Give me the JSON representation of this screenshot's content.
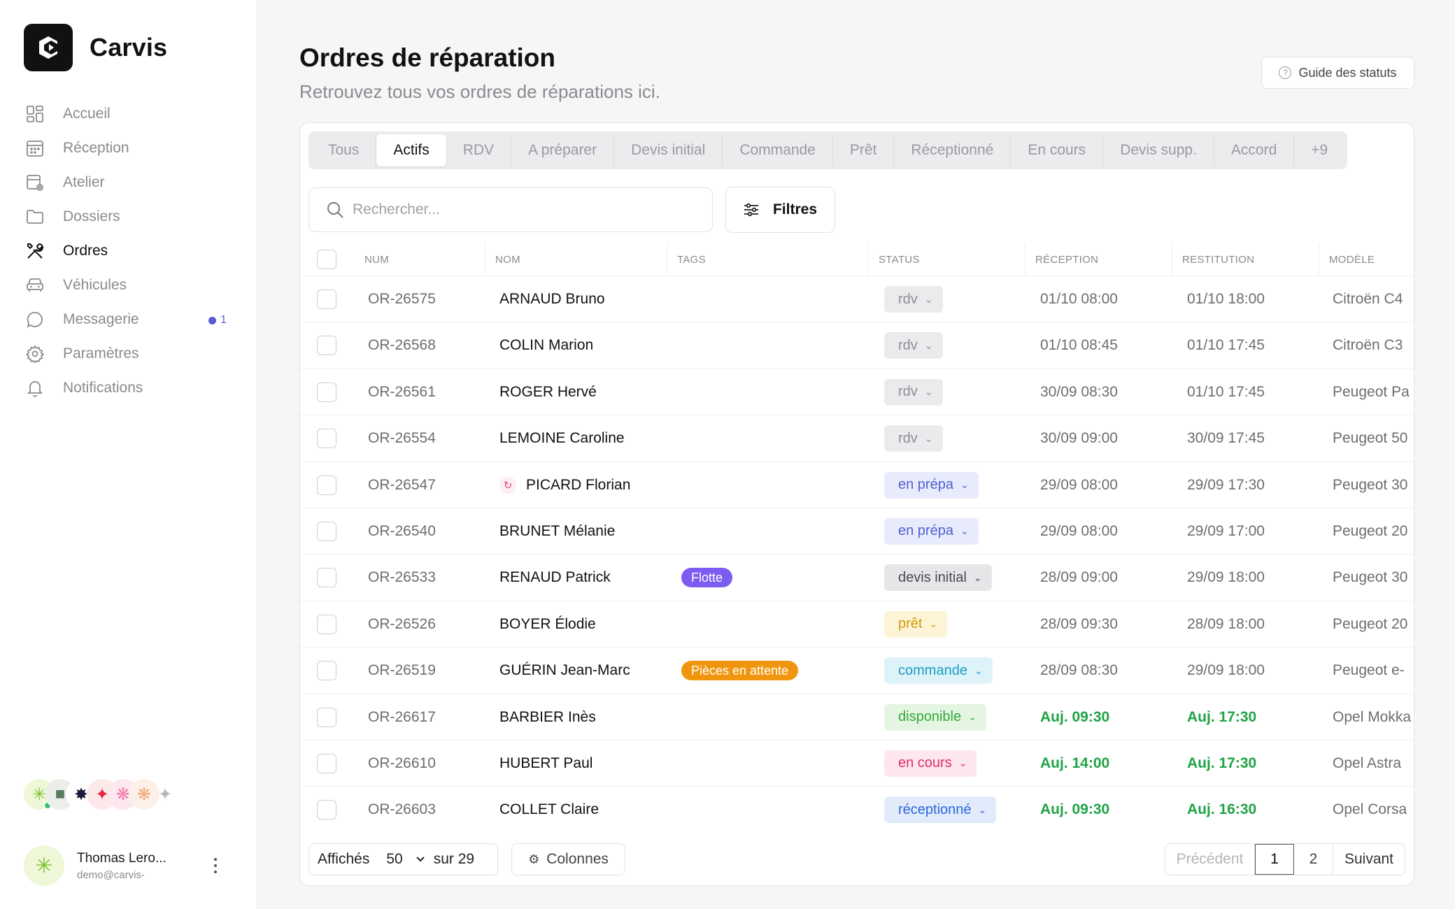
{
  "app": {
    "name": "Carvis"
  },
  "sidebar": {
    "items": [
      {
        "label": "Accueil",
        "icon": "dashboard-icon"
      },
      {
        "label": "Réception",
        "icon": "calendar-icon"
      },
      {
        "label": "Atelier",
        "icon": "workshop-icon"
      },
      {
        "label": "Dossiers",
        "icon": "folder-icon"
      },
      {
        "label": "Ordres",
        "icon": "tools-icon",
        "active": true
      },
      {
        "label": "Véhicules",
        "icon": "car-icon"
      },
      {
        "label": "Messagerie",
        "icon": "chat-icon",
        "badge": "1"
      },
      {
        "label": "Paramètres",
        "icon": "settings-icon"
      },
      {
        "label": "Notifications",
        "icon": "bell-icon"
      }
    ],
    "user": {
      "name": "Thomas Lero...",
      "email": "demo@carvis-"
    }
  },
  "header": {
    "title": "Ordres de réparation",
    "subtitle": "Retrouvez tous vos ordres de réparations ici.",
    "guide_label": "Guide des statuts"
  },
  "tabs": [
    "Tous",
    "Actifs",
    "RDV",
    "A préparer",
    "Devis initial",
    "Commande",
    "Prêt",
    "Réceptionné",
    "En cours",
    "Devis supp.",
    "Accord",
    "+9"
  ],
  "active_tab": "Actifs",
  "search": {
    "placeholder": "Rechercher..."
  },
  "filters_label": "Filtres",
  "columns": {
    "num": "NUM",
    "nom": "NOM",
    "tags": "TAGS",
    "status": "STATUS",
    "reception": "RÉCEPTION",
    "restitution": "RESTITUTION",
    "modele": "MODÈLE"
  },
  "status_colors": {
    "rdv": {
      "bg": "#ebebed",
      "fg": "#8e8e94"
    },
    "en prépa": {
      "bg": "#e8ebfb",
      "fg": "#5061d2"
    },
    "devis initial": {
      "bg": "#e6e6e8",
      "fg": "#4a4a50"
    },
    "prêt": {
      "bg": "#fdf4d8",
      "fg": "#d49a05"
    },
    "commande": {
      "bg": "#def3f9",
      "fg": "#1c9bc4"
    },
    "disponible": {
      "bg": "#e4f6e1",
      "fg": "#33a83c"
    },
    "en cours": {
      "bg": "#fde6ee",
      "fg": "#db2f6b"
    },
    "réceptionné": {
      "bg": "#e1ebfc",
      "fg": "#2b67d8"
    }
  },
  "rows": [
    {
      "num": "OR-26575",
      "nom": "ARNAUD Bruno",
      "tag": "",
      "status": "rdv",
      "reception": "01/10 08:00",
      "restitution": "01/10 18:00",
      "modele": "Citroën C4",
      "today": false
    },
    {
      "num": "OR-26568",
      "nom": "COLIN Marion",
      "tag": "",
      "status": "rdv",
      "reception": "01/10 08:45",
      "restitution": "01/10 17:45",
      "modele": "Citroën C3",
      "today": false
    },
    {
      "num": "OR-26561",
      "nom": "ROGER Hervé",
      "tag": "",
      "status": "rdv",
      "reception": "30/09 08:30",
      "restitution": "01/10 17:45",
      "modele": "Peugeot Pa",
      "today": false
    },
    {
      "num": "OR-26554",
      "nom": "LEMOINE Caroline",
      "tag": "",
      "status": "rdv",
      "reception": "30/09 09:00",
      "restitution": "30/09 17:45",
      "modele": "Peugeot 50",
      "today": false
    },
    {
      "num": "OR-26547",
      "nom": "PICARD Florian",
      "tag": "",
      "status": "en prépa",
      "reception": "29/09 08:00",
      "restitution": "29/09 17:30",
      "modele": "Peugeot 30",
      "today": false,
      "spinner": true
    },
    {
      "num": "OR-26540",
      "nom": "BRUNET Mélanie",
      "tag": "",
      "status": "en prépa",
      "reception": "29/09 08:00",
      "restitution": "29/09 17:00",
      "modele": "Peugeot 20",
      "today": false
    },
    {
      "num": "OR-26533",
      "nom": "RENAUD Patrick",
      "tag": "Flotte",
      "tag_color": "#7c5cf0",
      "status": "devis initial",
      "reception": "28/09 09:00",
      "restitution": "29/09 18:00",
      "modele": "Peugeot 30",
      "today": false
    },
    {
      "num": "OR-26526",
      "nom": "BOYER Élodie",
      "tag": "",
      "status": "prêt",
      "reception": "28/09 09:30",
      "restitution": "28/09 18:00",
      "modele": "Peugeot 20",
      "today": false
    },
    {
      "num": "OR-26519",
      "nom": "GUÉRIN Jean-Marc",
      "tag": "Pièces en attente",
      "tag_color": "#f0960e",
      "status": "commande",
      "reception": "28/09 08:30",
      "restitution": "29/09 18:00",
      "modele": "Peugeot e-",
      "today": false
    },
    {
      "num": "OR-26617",
      "nom": "BARBIER Inès",
      "tag": "",
      "status": "disponible",
      "reception": "Auj. 09:30",
      "restitution": "Auj. 17:30",
      "modele": "Opel Mokka",
      "today": true
    },
    {
      "num": "OR-26610",
      "nom": "HUBERT Paul",
      "tag": "",
      "status": "en cours",
      "reception": "Auj. 14:00",
      "restitution": "Auj. 17:30",
      "modele": "Opel Astra",
      "today": true
    },
    {
      "num": "OR-26603",
      "nom": "COLLET Claire",
      "tag": "",
      "status": "réceptionné",
      "reception": "Auj. 09:30",
      "restitution": "Auj. 16:30",
      "modele": "Opel Corsa",
      "today": true
    }
  ],
  "footer": {
    "shown_label": "Affichés",
    "per_page": "50",
    "total_label": "sur 29",
    "columns_label": "Colonnes",
    "prev_label": "Précédent",
    "pages": [
      "1",
      "2"
    ],
    "current_page": "1",
    "next_label": "Suivant"
  }
}
